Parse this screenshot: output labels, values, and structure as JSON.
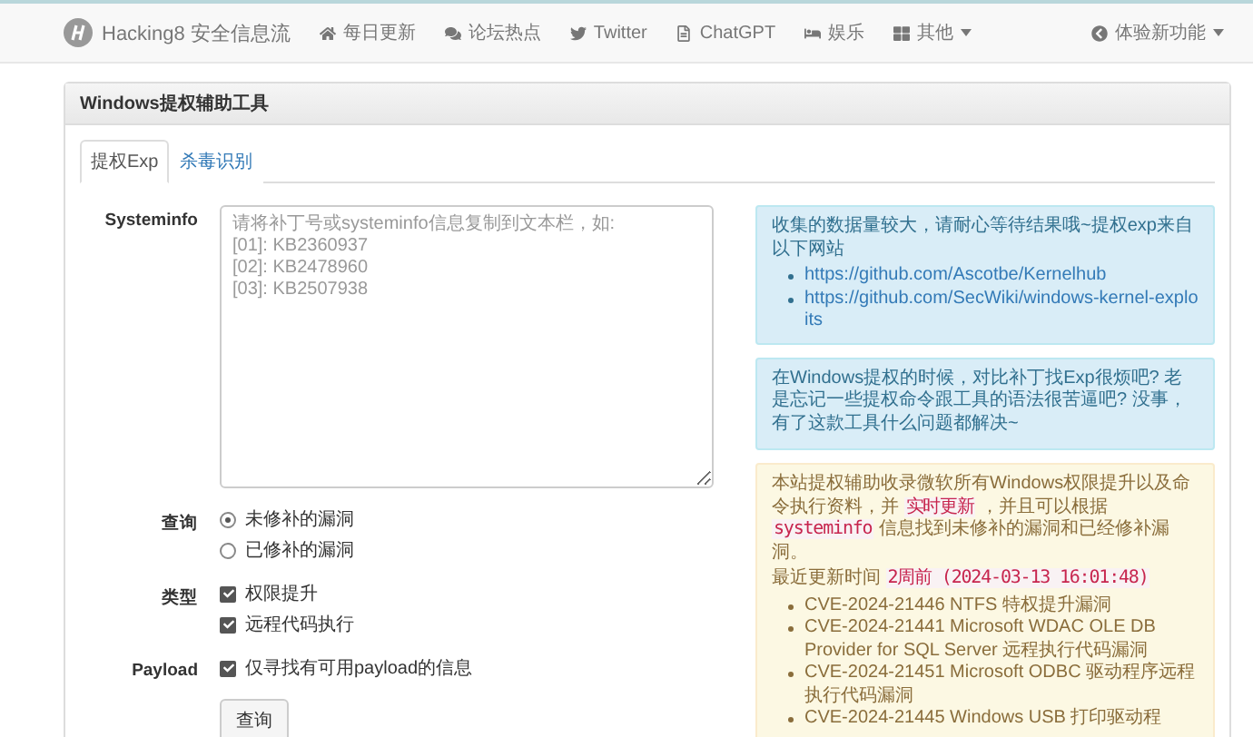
{
  "navbar": {
    "brand": "Hacking8 安全信息流",
    "items": [
      {
        "kind": "home",
        "label": "每日更新"
      },
      {
        "kind": "comments",
        "label": "论坛热点"
      },
      {
        "kind": "twitter",
        "label": "Twitter"
      },
      {
        "kind": "file",
        "label": "ChatGPT"
      },
      {
        "kind": "bed",
        "label": "娱乐"
      },
      {
        "kind": "grid",
        "label": "其他",
        "dropdown": true
      }
    ],
    "right": {
      "kind": "back",
      "label": "体验新功能",
      "dropdown": true
    }
  },
  "panel": {
    "title": "Windows提权辅助工具",
    "tabs": [
      {
        "label": "提权Exp",
        "selected": true
      },
      {
        "label": "杀毒识别",
        "selected": false
      }
    ],
    "form": {
      "systeminfo": {
        "label": "Systeminfo",
        "placeholder": "请将补丁号或systeminfo信息复制到文本栏，如:\n[01]: KB2360937\n[02]: KB2478960\n[03]: KB2507938"
      },
      "query": {
        "label": "查询",
        "options": [
          {
            "label": "未修补的漏洞",
            "selected": true
          },
          {
            "label": "已修补的漏洞",
            "selected": false
          }
        ]
      },
      "type": {
        "label": "类型",
        "options": [
          {
            "label": "权限提升",
            "checked": true
          },
          {
            "label": "远程代码执行",
            "checked": true
          }
        ]
      },
      "payload": {
        "label": "Payload",
        "options": [
          {
            "label": "仅寻找有可用payload的信息",
            "checked": true
          }
        ]
      },
      "submit": "查询"
    },
    "alerts": [
      {
        "kind": "info",
        "paragraphs": [
          [
            {
              "kind": "text",
              "text": "收集的数据量较大，请耐心等待结果哦~提权exp来自以下网站"
            }
          ]
        ],
        "links": [
          "https://github.com/Ascotbe/Kernelhub",
          "https://github.com/SecWiki/windows-kernel-exploits"
        ]
      },
      {
        "kind": "info",
        "paragraphs": [
          [
            {
              "kind": "text",
              "text": "在Windows提权的时候，对比补丁找Exp很烦吧? 老是忘记一些提权命令跟工具的语法很苦逼吧? 没事，有了这款工具什么问题都解决~"
            }
          ]
        ]
      },
      {
        "kind": "warning",
        "paragraphs": [
          [
            {
              "kind": "text",
              "text": "本站提权辅助收录微软所有Windows权限提升以及命令执行资料，并 "
            },
            {
              "kind": "code",
              "text": "实时更新"
            },
            {
              "kind": "text",
              "text": " ，并且可以根据 "
            },
            {
              "kind": "code",
              "text": "systeminfo"
            },
            {
              "kind": "text",
              "text": " 信息找到未修补的漏洞和已经修补漏洞。"
            }
          ],
          [
            {
              "kind": "text",
              "text": "最近更新时间 "
            },
            {
              "kind": "code",
              "text": "2周前 (2024-03-13 16:01:48)"
            }
          ]
        ],
        "items": [
          "CVE-2024-21446 NTFS 特权提升漏洞",
          "CVE-2024-21441 Microsoft WDAC OLE DB Provider for SQL Server 远程执行代码漏洞",
          "CVE-2024-21451 Microsoft ODBC 驱动程序远程执行代码漏洞",
          "CVE-2024-21445 Windows USB 打印驱动程"
        ]
      }
    ]
  }
}
